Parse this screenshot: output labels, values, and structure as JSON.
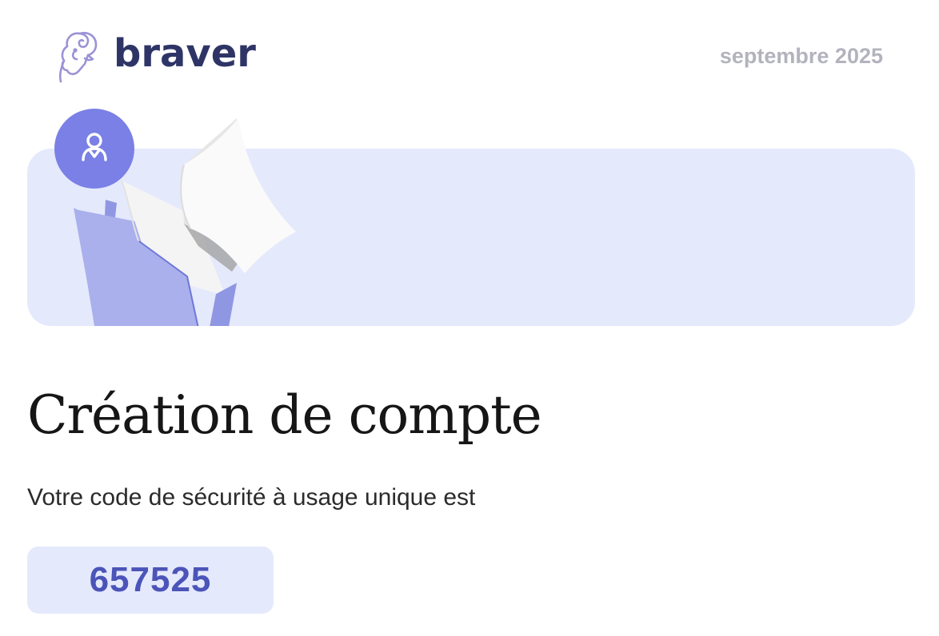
{
  "header": {
    "brand": "braver",
    "date": "septembre 2025",
    "logo_icon": "ram-logo-icon"
  },
  "banner": {
    "illustration_icon": "folder-with-documents-illustration",
    "badge_icon": "user-icon"
  },
  "main": {
    "title": "Création de compte",
    "intro": "Votre code de sécurité à usage unique est",
    "code": "657525"
  },
  "colors": {
    "brand_navy": "#2e3566",
    "date_gray": "#b3b3be",
    "banner_bg": "#e5e9fc",
    "accent": "#7a80e5",
    "code_text": "#4b54b8",
    "folder": "#a9b0ec"
  }
}
